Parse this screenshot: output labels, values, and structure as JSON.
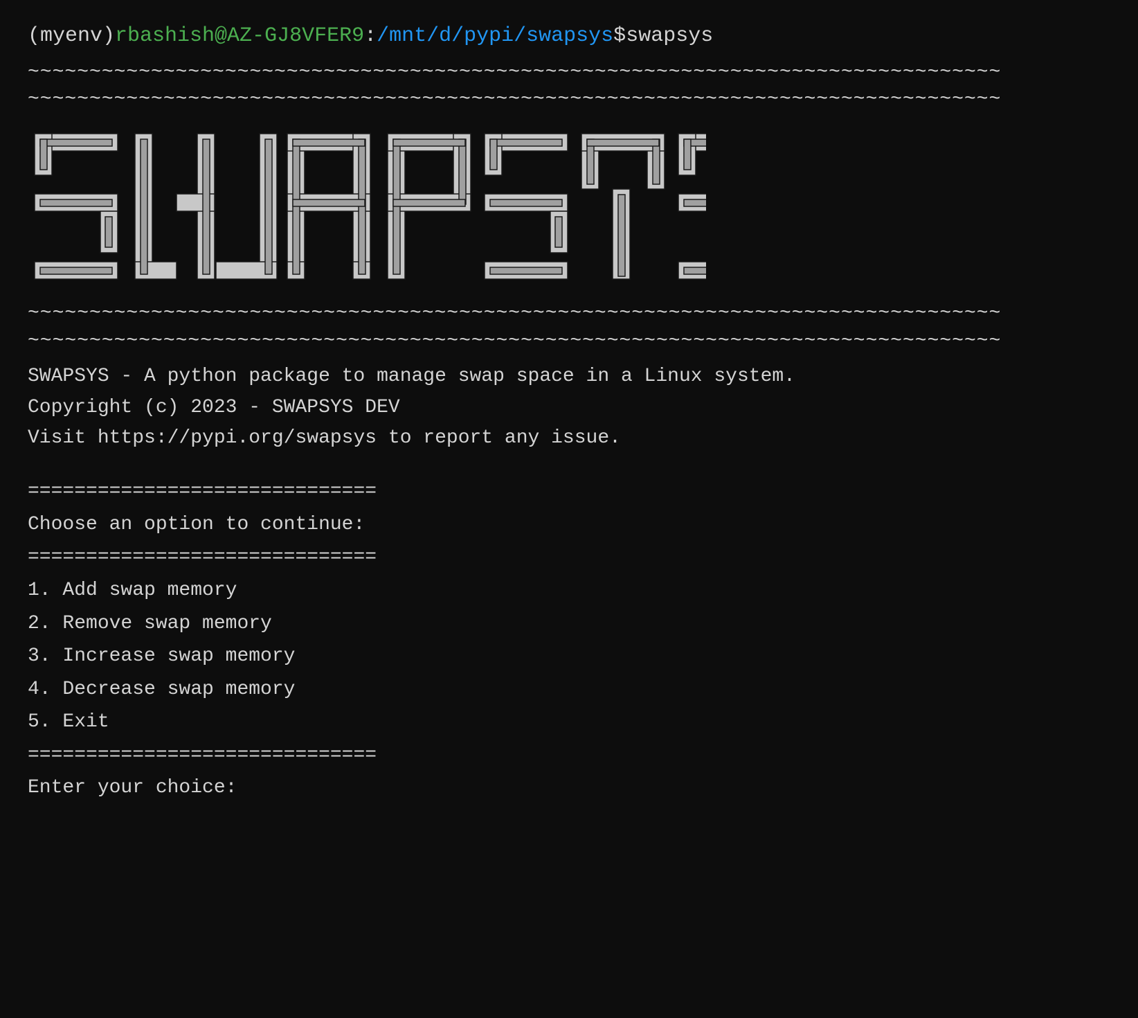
{
  "terminal": {
    "prompt": {
      "prefix": "(myenv) ",
      "user": "rbashish@AZ-GJ8VFER9",
      "separator": ":",
      "path": "/mnt/d/pypi/swapsys",
      "dollar": "$",
      "command": " swapsys"
    },
    "tilde_lines": [
      "~~~~~~~~~~~~~~~~~~~~~~~~~~~~~~~~~~~~~~~~~~~~~~~~~~~~~~~~~~~~~~~~~~~~~~~~~~~~~~~",
      "~~~~~~~~~~~~~~~~~~~~~~~~~~~~~~~~~~~~~~~~~~~~~~~~~~~~~~~~~~~~~~~~~~~~~~~~~~~~~~~"
    ],
    "tilde_lines_bottom": [
      "~~~~~~~~~~~~~~~~~~~~~~~~~~~~~~~~~~~~~~~~~~~~~~~~~~~~~~~~~~~~~~~~~~~~~~~~~~~~~~~",
      "~~~~~~~~~~~~~~~~~~~~~~~~~~~~~~~~~~~~~~~~~~~~~~~~~~~~~~~~~~~~~~~~~~~~~~~~~~~~~~~"
    ],
    "logo_text": "SWAPSYS",
    "info": {
      "line1": "SWAPSYS - A python package to manage swap space in a Linux system.",
      "line2": "Copyright (c) 2023 - SWAPSYS DEV",
      "line3": "Visit https://pypi.org/swapsys to report any issue."
    },
    "separator_equals": "==============================",
    "menu_title": "Choose an option to continue:",
    "menu_items": [
      "1.  Add swap memory",
      "2.  Remove swap memory",
      "3.  Increase swap memory",
      "4.  Decrease swap memory",
      "5.  Exit"
    ],
    "input_prompt": "Enter your choice:"
  }
}
